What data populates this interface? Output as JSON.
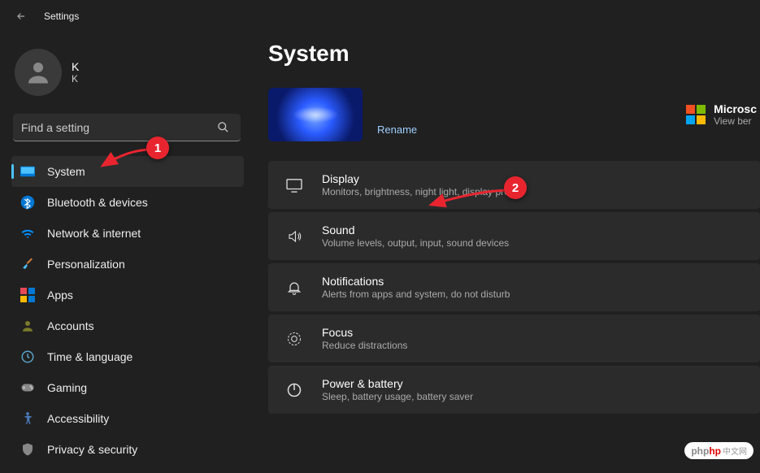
{
  "header": {
    "title": "Settings"
  },
  "profile": {
    "name": "K",
    "sub": "K"
  },
  "search": {
    "placeholder": "Find a setting"
  },
  "sidebar": {
    "items": [
      {
        "label": "System"
      },
      {
        "label": "Bluetooth & devices"
      },
      {
        "label": "Network & internet"
      },
      {
        "label": "Personalization"
      },
      {
        "label": "Apps"
      },
      {
        "label": "Accounts"
      },
      {
        "label": "Time & language"
      },
      {
        "label": "Gaming"
      },
      {
        "label": "Accessibility"
      },
      {
        "label": "Privacy & security"
      }
    ]
  },
  "main": {
    "title": "System",
    "rename": "Rename",
    "ms365": {
      "title": "Microsc",
      "sub": "View ber"
    },
    "cards": [
      {
        "title": "Display",
        "sub": "Monitors, brightness, night light, display profile"
      },
      {
        "title": "Sound",
        "sub": "Volume levels, output, input, sound devices"
      },
      {
        "title": "Notifications",
        "sub": "Alerts from apps and system, do not disturb"
      },
      {
        "title": "Focus",
        "sub": "Reduce distractions"
      },
      {
        "title": "Power & battery",
        "sub": "Sleep, battery usage, battery saver"
      }
    ]
  },
  "annotations": {
    "one": "1",
    "two": "2"
  },
  "watermark": {
    "p": "php",
    "cn": "中文网"
  }
}
